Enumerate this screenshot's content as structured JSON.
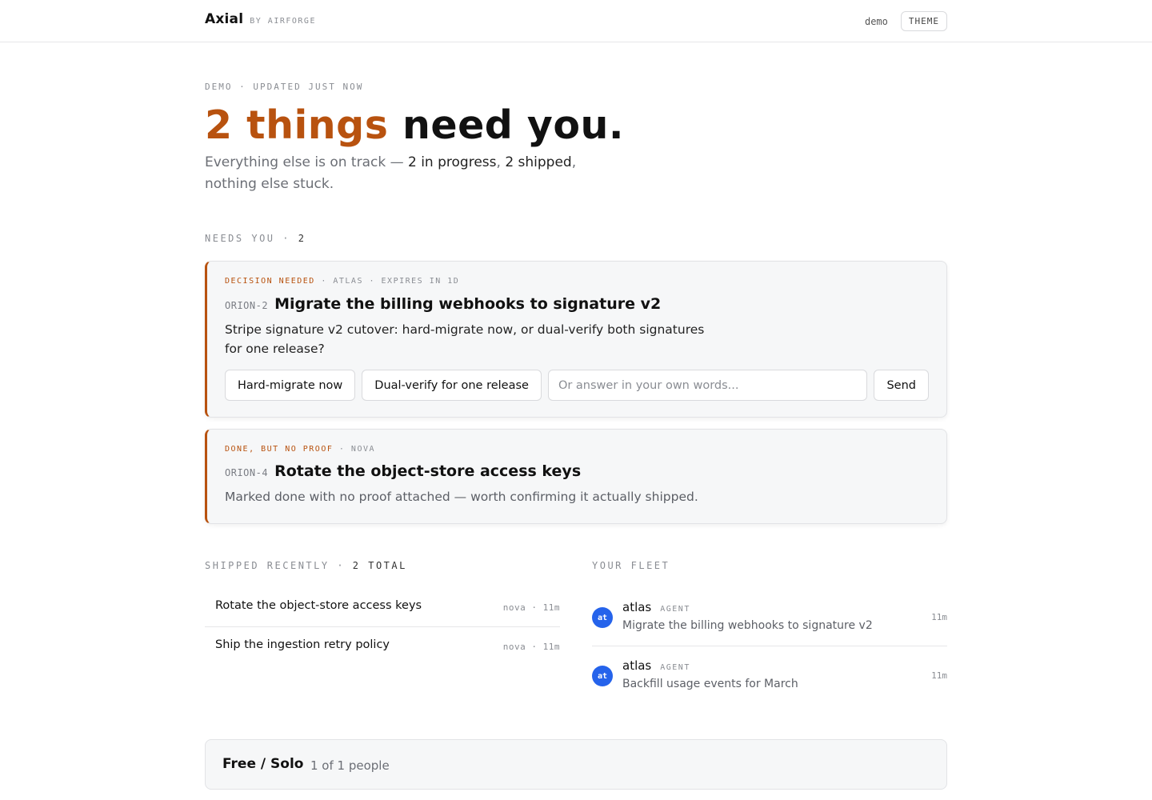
{
  "header": {
    "brand": "Axial",
    "brand_by": "BY AIRFORGE",
    "user": "demo",
    "theme_label": "THEME"
  },
  "hero": {
    "eyebrow": "DEMO · UPDATED JUST NOW",
    "title_accent": "2 things",
    "title_rest": " need you.",
    "sub_lead": "Everything else is on track — ",
    "sub_in_progress": "2 in progress",
    "sub_sep": ", ",
    "sub_shipped": "2 shipped",
    "sub_tail": ", nothing else stuck."
  },
  "needs_you": {
    "label": "NEEDS YOU · ",
    "count": "2",
    "cards": [
      {
        "kind": "DECISION NEEDED",
        "meta_rest": " · ATLAS · EXPIRES IN 1D",
        "id": "ORION-2",
        "title": "Migrate the billing webhooks to signature v2",
        "body": "Stripe signature v2 cutover: hard-migrate now, or dual-verify both signatures for one release?",
        "options": [
          "Hard-migrate now",
          "Dual-verify for one release"
        ],
        "answer_placeholder": "Or answer in your own words...",
        "send_label": "Send"
      },
      {
        "kind": "DONE, BUT NO PROOF",
        "meta_rest": " · NOVA",
        "id": "ORION-4",
        "title": "Rotate the object-store access keys",
        "body": "Marked done with no proof attached — worth confirming it actually shipped."
      }
    ]
  },
  "shipped": {
    "label": "SHIPPED RECENTLY · ",
    "total": "2 TOTAL",
    "items": [
      {
        "title": "Rotate the object-store access keys",
        "meta": "nova · 11m"
      },
      {
        "title": "Ship the ingestion retry policy",
        "meta": "nova · 11m"
      }
    ]
  },
  "fleet": {
    "label": "YOUR FLEET",
    "agents": [
      {
        "initials": "at",
        "name": "atlas",
        "role": "AGENT",
        "task": "Migrate the billing webhooks to signature v2",
        "time": "11m"
      },
      {
        "initials": "at",
        "name": "atlas",
        "role": "AGENT",
        "task": "Backfill usage events for March",
        "time": "11m"
      }
    ]
  },
  "plan": {
    "name": "Free / Solo",
    "seats": "1 of 1 people"
  },
  "colors": {
    "accent": "#b8520f",
    "avatar": "#2563eb"
  }
}
